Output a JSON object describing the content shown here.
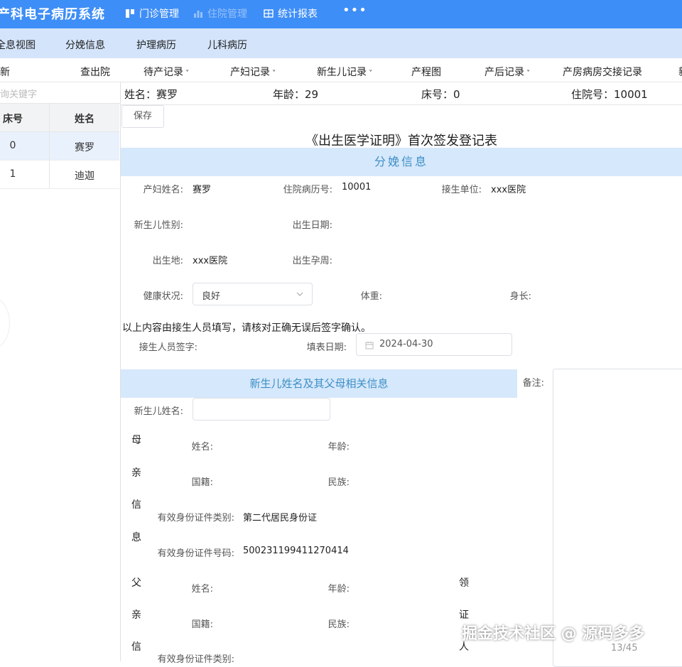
{
  "app": {
    "title": "产科电子病历系统"
  },
  "top_nav": [
    {
      "label": "门诊管理",
      "icon": "clinic-icon"
    },
    {
      "label": "住院管理",
      "icon": "bar-chart-icon"
    },
    {
      "label": "统计报表",
      "icon": "table-icon"
    }
  ],
  "top_more": "•••",
  "secondary_tabs": [
    "全息视图",
    "分娩信息",
    "护理病历",
    "儿科病历"
  ],
  "sub_nav": {
    "left_items": [
      "新",
      "查出院"
    ],
    "items": [
      "待产记录",
      "产妇记录",
      "新生儿记录",
      "产程图",
      "产后记录",
      "产房病房交接记录",
      "新"
    ],
    "dropdown_flags": [
      true,
      true,
      true,
      false,
      true,
      false,
      false
    ]
  },
  "sidebar": {
    "search_placeholder": "询关键字",
    "headers": {
      "bed": "床号",
      "name": "姓名"
    },
    "rows": [
      {
        "bed": "0",
        "name": "赛罗"
      },
      {
        "bed": "1",
        "name": "迪迦"
      }
    ]
  },
  "patient": {
    "name": "姓名：赛罗",
    "age": "年龄：29",
    "bed": "床号：0",
    "admission": "住院号：10001"
  },
  "toolbar": {
    "save_label": "保存"
  },
  "form": {
    "title": "《出生医学证明》首次签发登记表",
    "section1_title": "分娩信息",
    "mother_name_label": "产妇姓名:",
    "mother_name": "赛罗",
    "record_no_label": "住院病历号:",
    "record_no": "10001",
    "delivery_unit_label": "接生单位:",
    "delivery_unit": "xxx医院",
    "baby_gender_label": "新生儿性别:",
    "birth_date_label": "出生日期:",
    "birthplace_label": "出生地:",
    "birthplace": "xxx医院",
    "gestation_label": "出生孕周:",
    "health_label": "健康状况:",
    "health_value": "良好",
    "weight_label": "体重:",
    "height_label": "身长:",
    "notice": "以上内容由接生人员填写，请核对正确无误后签字确认。",
    "signer_label": "接生人员签字:",
    "fill_date_label": "填表日期:",
    "fill_date": "2024-04-30",
    "section2_title": "新生儿姓名及其父母相关信息",
    "remark_label": "备注:",
    "baby_name_label": "新生儿姓名:",
    "mother_block_label": [
      "母",
      "亲",
      "信",
      "息"
    ],
    "father_block_label": [
      "父",
      "亲",
      "信"
    ],
    "receiver_block_label": [
      "领",
      "证",
      "人"
    ],
    "parent_name_label": "姓名:",
    "parent_age_label": "年龄:",
    "nationality_label": "国籍:",
    "ethnicity_label": "民族:",
    "id_type_label": "有效身份证件类别:",
    "mother_id_type": "第二代居民身份证",
    "id_no_label": "有效身份证件号码:",
    "mother_id_no": "500231199411270414",
    "father_id_type_label_partial": "有效身份证件类别:"
  },
  "overlay": {
    "watermark": "掘金技术社区 @ 源码多多",
    "pager": "13/45"
  },
  "colors": {
    "primary": "#3e8ef7",
    "tab_bg": "#d4e4fb",
    "band_bg": "#d6e8fb",
    "band_text": "#3d8fc7"
  }
}
